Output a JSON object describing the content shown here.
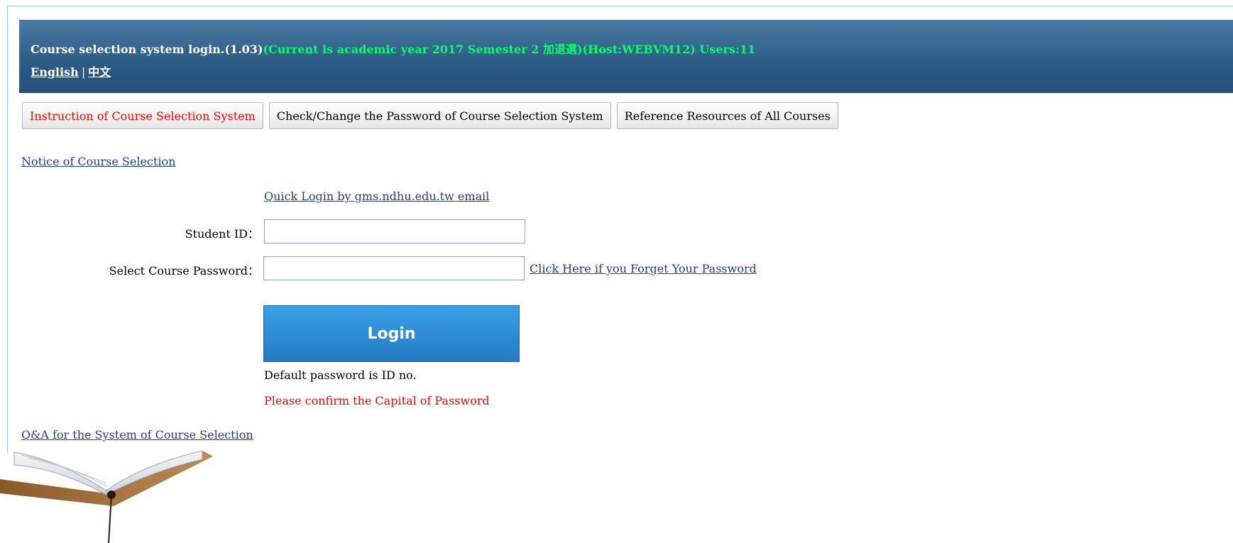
{
  "header": {
    "title": "Course selection system login.(1.03)",
    "status": "(Current is academic year 2017 Semester 2 加退選)(Host:WEBVM12) Users:11",
    "lang_english": "English",
    "lang_separator": "|",
    "lang_chinese": "中文"
  },
  "tabs": [
    {
      "label": "Instruction of Course Selection System"
    },
    {
      "label": "Check/Change the Password of Course Selection System"
    },
    {
      "label": "Reference Resources of All Courses"
    }
  ],
  "links": {
    "notice": "Notice of Course Selection",
    "quick_login": "Quick Login by gms.ndhu.edu.tw email",
    "forgot_password": "Click Here if you Forget Your Password",
    "qa": "Q&A for the System of Course Selection"
  },
  "form": {
    "student_id_label": "Student ID：",
    "student_id_value": "",
    "password_label": "Select Course Password：",
    "password_value": "",
    "login_label": "Login",
    "default_note": "Default password is ID no.",
    "capital_note": "Please confirm the Capital of Password"
  },
  "colors": {
    "header_bg": "#2e5d88",
    "status_green": "#00ff66",
    "accent_red": "#ff0000",
    "link_blue": "#1d3f86",
    "login_blue": "#2479c4"
  }
}
